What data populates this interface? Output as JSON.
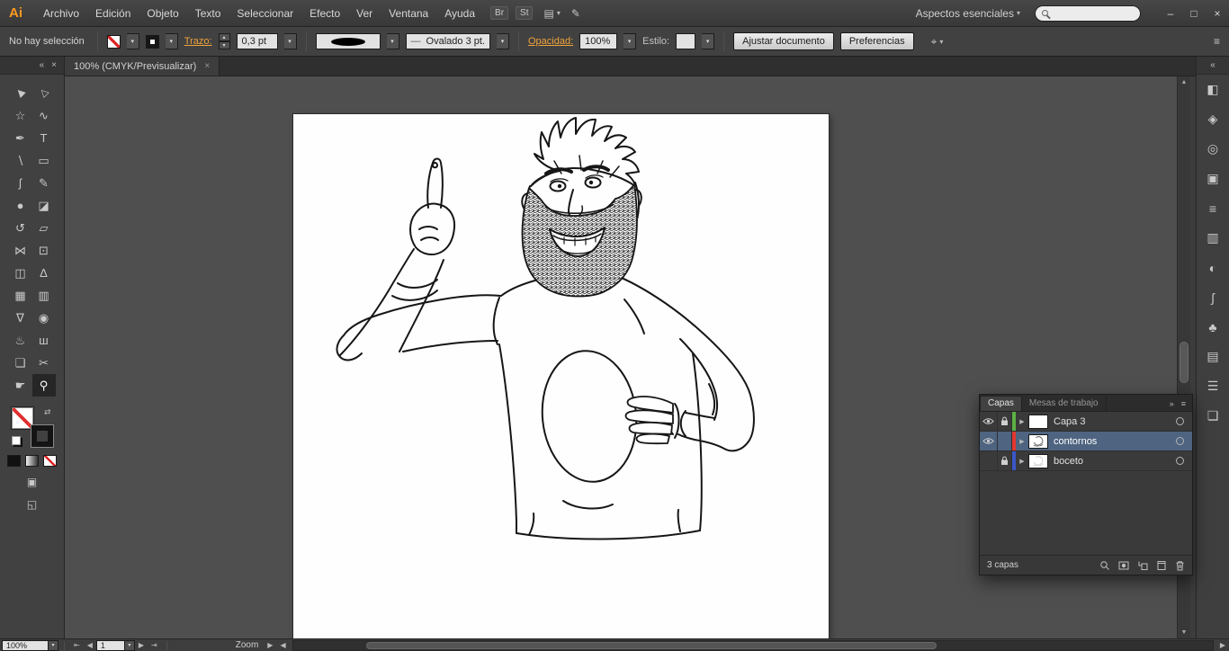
{
  "app": {
    "logo": "Ai",
    "workspace_switcher": "Aspectos esenciales",
    "search_value": ""
  },
  "menubar": {
    "menus": [
      {
        "key": "archivo",
        "label": "Archivo"
      },
      {
        "key": "edicion",
        "label": "Edición"
      },
      {
        "key": "obje",
        "label": "Objeto"
      },
      {
        "key": "texto",
        "label": "Texto"
      },
      {
        "key": "seleccionar",
        "label": "Seleccionar"
      },
      {
        "key": "efecto",
        "label": "Efecto"
      },
      {
        "key": "ver",
        "label": "Ver"
      },
      {
        "key": "ventana",
        "label": "Ventana"
      },
      {
        "key": "ayuda",
        "label": "Ayuda"
      }
    ],
    "bridge_button": "Br",
    "stock_button": "St"
  },
  "control_bar": {
    "selection_status": "No hay selección",
    "stroke_label": "Trazo:",
    "stroke_value": "0,3 pt",
    "brush_profile": "Ovalado 3 pt.",
    "opacity_label": "Opacidad:",
    "opacity_value": "100%",
    "style_label": "Estilo:",
    "fit_document_button": "Ajustar documento",
    "preferences_button": "Preferencias"
  },
  "document": {
    "tab_title": "100% (CMYK/Previsualizar)"
  },
  "toolbar": {
    "tools": [
      {
        "key": "selection",
        "glyph": "▶"
      },
      {
        "key": "direct-selection",
        "glyph": "▷"
      },
      {
        "key": "magic-wand",
        "glyph": "☆"
      },
      {
        "key": "lasso",
        "glyph": "∿"
      },
      {
        "key": "pen",
        "glyph": "✒"
      },
      {
        "key": "type",
        "glyph": "T"
      },
      {
        "key": "line-segment",
        "glyph": "∖"
      },
      {
        "key": "rectangle",
        "glyph": "▭"
      },
      {
        "key": "paintbrush",
        "glyph": "ʃ"
      },
      {
        "key": "pencil",
        "glyph": "✎"
      },
      {
        "key": "blob-brush",
        "glyph": "●"
      },
      {
        "key": "eraser",
        "glyph": "◪"
      },
      {
        "key": "rotate",
        "glyph": "↺"
      },
      {
        "key": "scale",
        "glyph": "▱"
      },
      {
        "key": "width",
        "glyph": "⋈"
      },
      {
        "key": "free-transform",
        "glyph": "⊡"
      },
      {
        "key": "shape-builder",
        "glyph": "◫"
      },
      {
        "key": "perspective-grid",
        "glyph": "Δ"
      },
      {
        "key": "mesh",
        "glyph": "▦"
      },
      {
        "key": "gradient",
        "glyph": "▥"
      },
      {
        "key": "eyedropper",
        "glyph": "∇"
      },
      {
        "key": "blend",
        "glyph": "◉"
      },
      {
        "key": "symbol-sprayer",
        "glyph": "♨"
      },
      {
        "key": "column-graph",
        "glyph": "ш"
      },
      {
        "key": "artboard",
        "glyph": "❏"
      },
      {
        "key": "slice",
        "glyph": "✂"
      },
      {
        "key": "hand",
        "glyph": "☛"
      },
      {
        "key": "zoom",
        "glyph": "⚲",
        "active": true
      }
    ]
  },
  "dock": {
    "panels": [
      {
        "key": "color",
        "glyph": "◧"
      },
      {
        "key": "color-guide",
        "glyph": "◈"
      },
      {
        "key": "appearance",
        "glyph": "◎"
      },
      {
        "key": "graphic-styles",
        "glyph": "▣"
      },
      {
        "key": "stroke",
        "glyph": "≡"
      },
      {
        "key": "gradient",
        "glyph": "▥"
      },
      {
        "key": "transparency",
        "glyph": "◐"
      },
      {
        "key": "brushes",
        "glyph": "ʃ"
      },
      {
        "key": "symbols",
        "glyph": "♣"
      },
      {
        "key": "swatches",
        "glyph": "▤"
      },
      {
        "key": "layers",
        "glyph": "☰"
      },
      {
        "key": "artboards",
        "glyph": "❏"
      }
    ]
  },
  "layers_panel": {
    "tab_layers": "Capas",
    "tab_artboards": "Mesas de trabajo",
    "layers": [
      {
        "key": "capa-3",
        "name": "Capa 3",
        "color": "#5cb043",
        "color_style": "background:#5cb043",
        "visible": true,
        "locked": true,
        "selected": false,
        "art": false,
        "faint": false
      },
      {
        "key": "contornos",
        "name": "contornos",
        "color": "#e2372f",
        "color_style": "background:#e2372f",
        "visible": true,
        "locked": false,
        "selected": true,
        "art": true,
        "faint": false
      },
      {
        "key": "boceto",
        "name": "boceto",
        "color": "#3a56c8",
        "color_style": "background:#3a56c8",
        "visible": false,
        "locked": true,
        "selected": false,
        "art": true,
        "faint": true
      }
    ],
    "layer_count_label": "3 capas",
    "button_icons": [
      "locate-object-icon",
      "clip-mask-icon",
      "new-sublayer-icon",
      "new-layer-icon",
      "delete-icon"
    ]
  },
  "status_bar": {
    "zoom_value": "100%",
    "artboard_nav_value": "1",
    "status_display_label": "Zoom"
  },
  "icons": {
    "dropdown": "▾",
    "stepper_up": "▴",
    "stepper_down": "▾",
    "minimize": "–",
    "restore": "□",
    "close": "×",
    "tab_close": "×",
    "collapse_left": "«",
    "collapse_right": "»",
    "panel_menu": "≡",
    "scroll_up": "▲",
    "scroll_down": "▼",
    "scroll_left": "◀",
    "scroll_right": "▶",
    "nav_first": "⇤",
    "nav_prev": "◀",
    "nav_next": "▶",
    "nav_last": "⇥",
    "status_arrow": "▶",
    "swap": "⇄",
    "profile_dash": "—",
    "select_similar": "⌖",
    "arrange_documents": "▤",
    "share": "✎"
  },
  "colors": {
    "accent_orange": "#f0a43c",
    "logo_orange": "#ff9a1e",
    "selected_row": "#4e6480",
    "layer_green": "#5cb043",
    "layer_red": "#e2372f",
    "layer_blue": "#3a56c8",
    "canvas_bg": "#4f4f4f",
    "panel_bg": "#3a3a3a"
  }
}
